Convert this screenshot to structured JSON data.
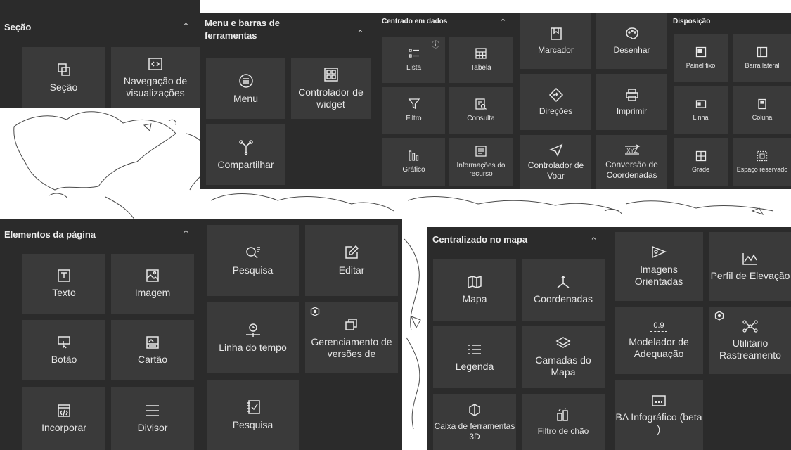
{
  "sections": {
    "secao": {
      "title": "Seção",
      "items": [
        {
          "label": "Seção",
          "icon": "section-icon"
        },
        {
          "label": "Navegação de visualizações",
          "icon": "views-navigation-icon"
        }
      ]
    },
    "menu": {
      "title": "Menu e barras de ferramentas",
      "items": [
        {
          "label": "Menu",
          "icon": "menu-icon"
        },
        {
          "label": "Controlador de widget",
          "icon": "widget-controller-icon"
        },
        {
          "label": "Compartilhar",
          "icon": "share-icon"
        }
      ]
    },
    "dados": {
      "title": "Centrado em dados",
      "items": [
        {
          "label": "Lista",
          "icon": "list-icon"
        },
        {
          "label": "Tabela",
          "icon": "table-icon"
        },
        {
          "label": "Filtro",
          "icon": "filter-icon"
        },
        {
          "label": "Consulta",
          "icon": "query-icon"
        },
        {
          "label": "Gráfico",
          "icon": "chart-icon"
        },
        {
          "label": "Informações do recurso",
          "icon": "feature-info-icon"
        }
      ]
    },
    "misc": {
      "items": [
        {
          "label": "Marcador",
          "icon": "bookmark-icon"
        },
        {
          "label": "Desenhar",
          "icon": "draw-icon"
        },
        {
          "label": "Direções",
          "icon": "directions-icon"
        },
        {
          "label": "Imprimir",
          "icon": "print-icon"
        },
        {
          "label": "Controlador de Voar",
          "icon": "fly-controller-icon"
        },
        {
          "label": "Conversão de Coordenadas",
          "icon": "coordinate-conversion-icon"
        }
      ]
    },
    "disposicao": {
      "title": "Disposição",
      "items": [
        {
          "label": "Painel fixo",
          "icon": "fixed-panel-icon"
        },
        {
          "label": "Barra lateral",
          "icon": "sidebar-icon"
        },
        {
          "label": "Linha",
          "icon": "row-icon"
        },
        {
          "label": "Coluna",
          "icon": "column-icon"
        },
        {
          "label": "Grade",
          "icon": "grid-icon"
        },
        {
          "label": "Espaço reservado",
          "icon": "placeholder-icon"
        }
      ]
    },
    "pagina": {
      "title": "Elementos da página",
      "items": [
        {
          "label": "Texto",
          "icon": "text-icon"
        },
        {
          "label": "Imagem",
          "icon": "image-icon"
        },
        {
          "label": "Botão",
          "icon": "button-icon"
        },
        {
          "label": "Cartão",
          "icon": "card-icon"
        },
        {
          "label": "Incorporar",
          "icon": "embed-icon"
        },
        {
          "label": "Divisor",
          "icon": "divider-icon"
        }
      ]
    },
    "pesquisa": {
      "items": [
        {
          "label": "Pesquisa",
          "icon": "search-icon"
        },
        {
          "label": "Editar",
          "icon": "edit-icon"
        },
        {
          "label": "Linha do tempo",
          "icon": "timeline-icon"
        },
        {
          "label": "Gerenciamento de versões de",
          "icon": "version-management-icon"
        },
        {
          "label": "Pesquisa",
          "icon": "survey-icon"
        }
      ]
    },
    "mapa": {
      "title": "Centralizado no mapa",
      "items": [
        {
          "label": "Mapa",
          "icon": "map-icon"
        },
        {
          "label": "Coordenadas",
          "icon": "coordinates-icon"
        },
        {
          "label": "Legenda",
          "icon": "legend-icon"
        },
        {
          "label": "Camadas do Mapa",
          "icon": "layers-icon"
        },
        {
          "label": "Caixa de ferramentas 3D",
          "icon": "3d-toolbox-icon"
        },
        {
          "label": "Filtro de chão",
          "icon": "ground-filter-icon"
        }
      ]
    },
    "extra": {
      "items": [
        {
          "label": "Imagens Orientadas",
          "icon": "oriented-imagery-icon"
        },
        {
          "label": "Perfil de Elevação",
          "icon": "elevation-profile-icon"
        },
        {
          "label": "Modelador de Adequação",
          "icon": "suitability-modeler-icon",
          "icon_text": "0.9"
        },
        {
          "label": "Utilitário Rastreamento",
          "icon": "utility-trace-icon"
        },
        {
          "label": "BA Infográfico (beta )",
          "icon": "infographic-icon"
        }
      ]
    }
  }
}
